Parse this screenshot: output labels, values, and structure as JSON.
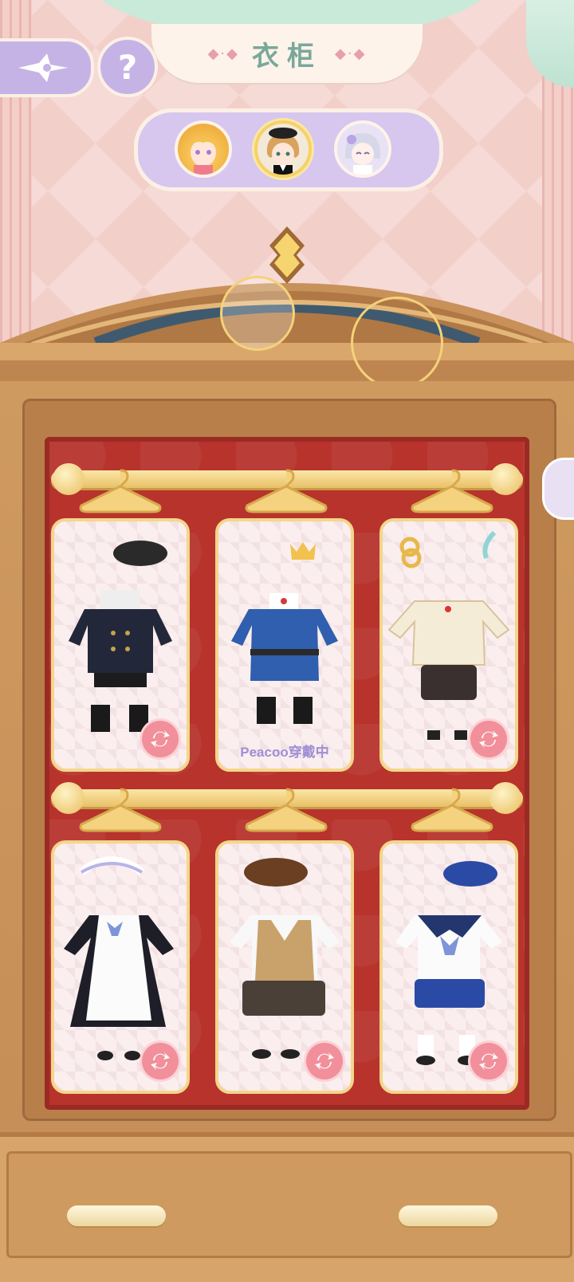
{
  "header": {
    "title": "衣柜",
    "title_deco_left": "◆·◆",
    "title_deco_right": "◆·◆"
  },
  "buttons": {
    "back_icon": "star-back-icon",
    "help_label": "?"
  },
  "characters": [
    {
      "name": "blonde-girl-avatar",
      "selected": false
    },
    {
      "name": "peacoo-avatar",
      "selected": true
    },
    {
      "name": "silver-hair-avatar",
      "selected": false
    }
  ],
  "outfits": [
    {
      "name": "black-military-outfit",
      "wearing_label": ""
    },
    {
      "name": "blue-prince-outfit",
      "wearing_label": "Peacoo穿戴中"
    },
    {
      "name": "cream-chinese-outfit",
      "wearing_label": ""
    },
    {
      "name": "maid-outfit",
      "wearing_label": ""
    },
    {
      "name": "school-vest-outfit",
      "wearing_label": ""
    },
    {
      "name": "sailor-outfit",
      "wearing_label": ""
    }
  ],
  "colors": {
    "accent_lavender": "#c6b3e6",
    "title_green": "#79a89a",
    "wardrobe_wood": "#c48c56",
    "interior_red": "#b7332c",
    "card_border_gold": "#f3d68a",
    "swap_pink": "#f1909a",
    "wearing_text": "#9e8fd6"
  }
}
